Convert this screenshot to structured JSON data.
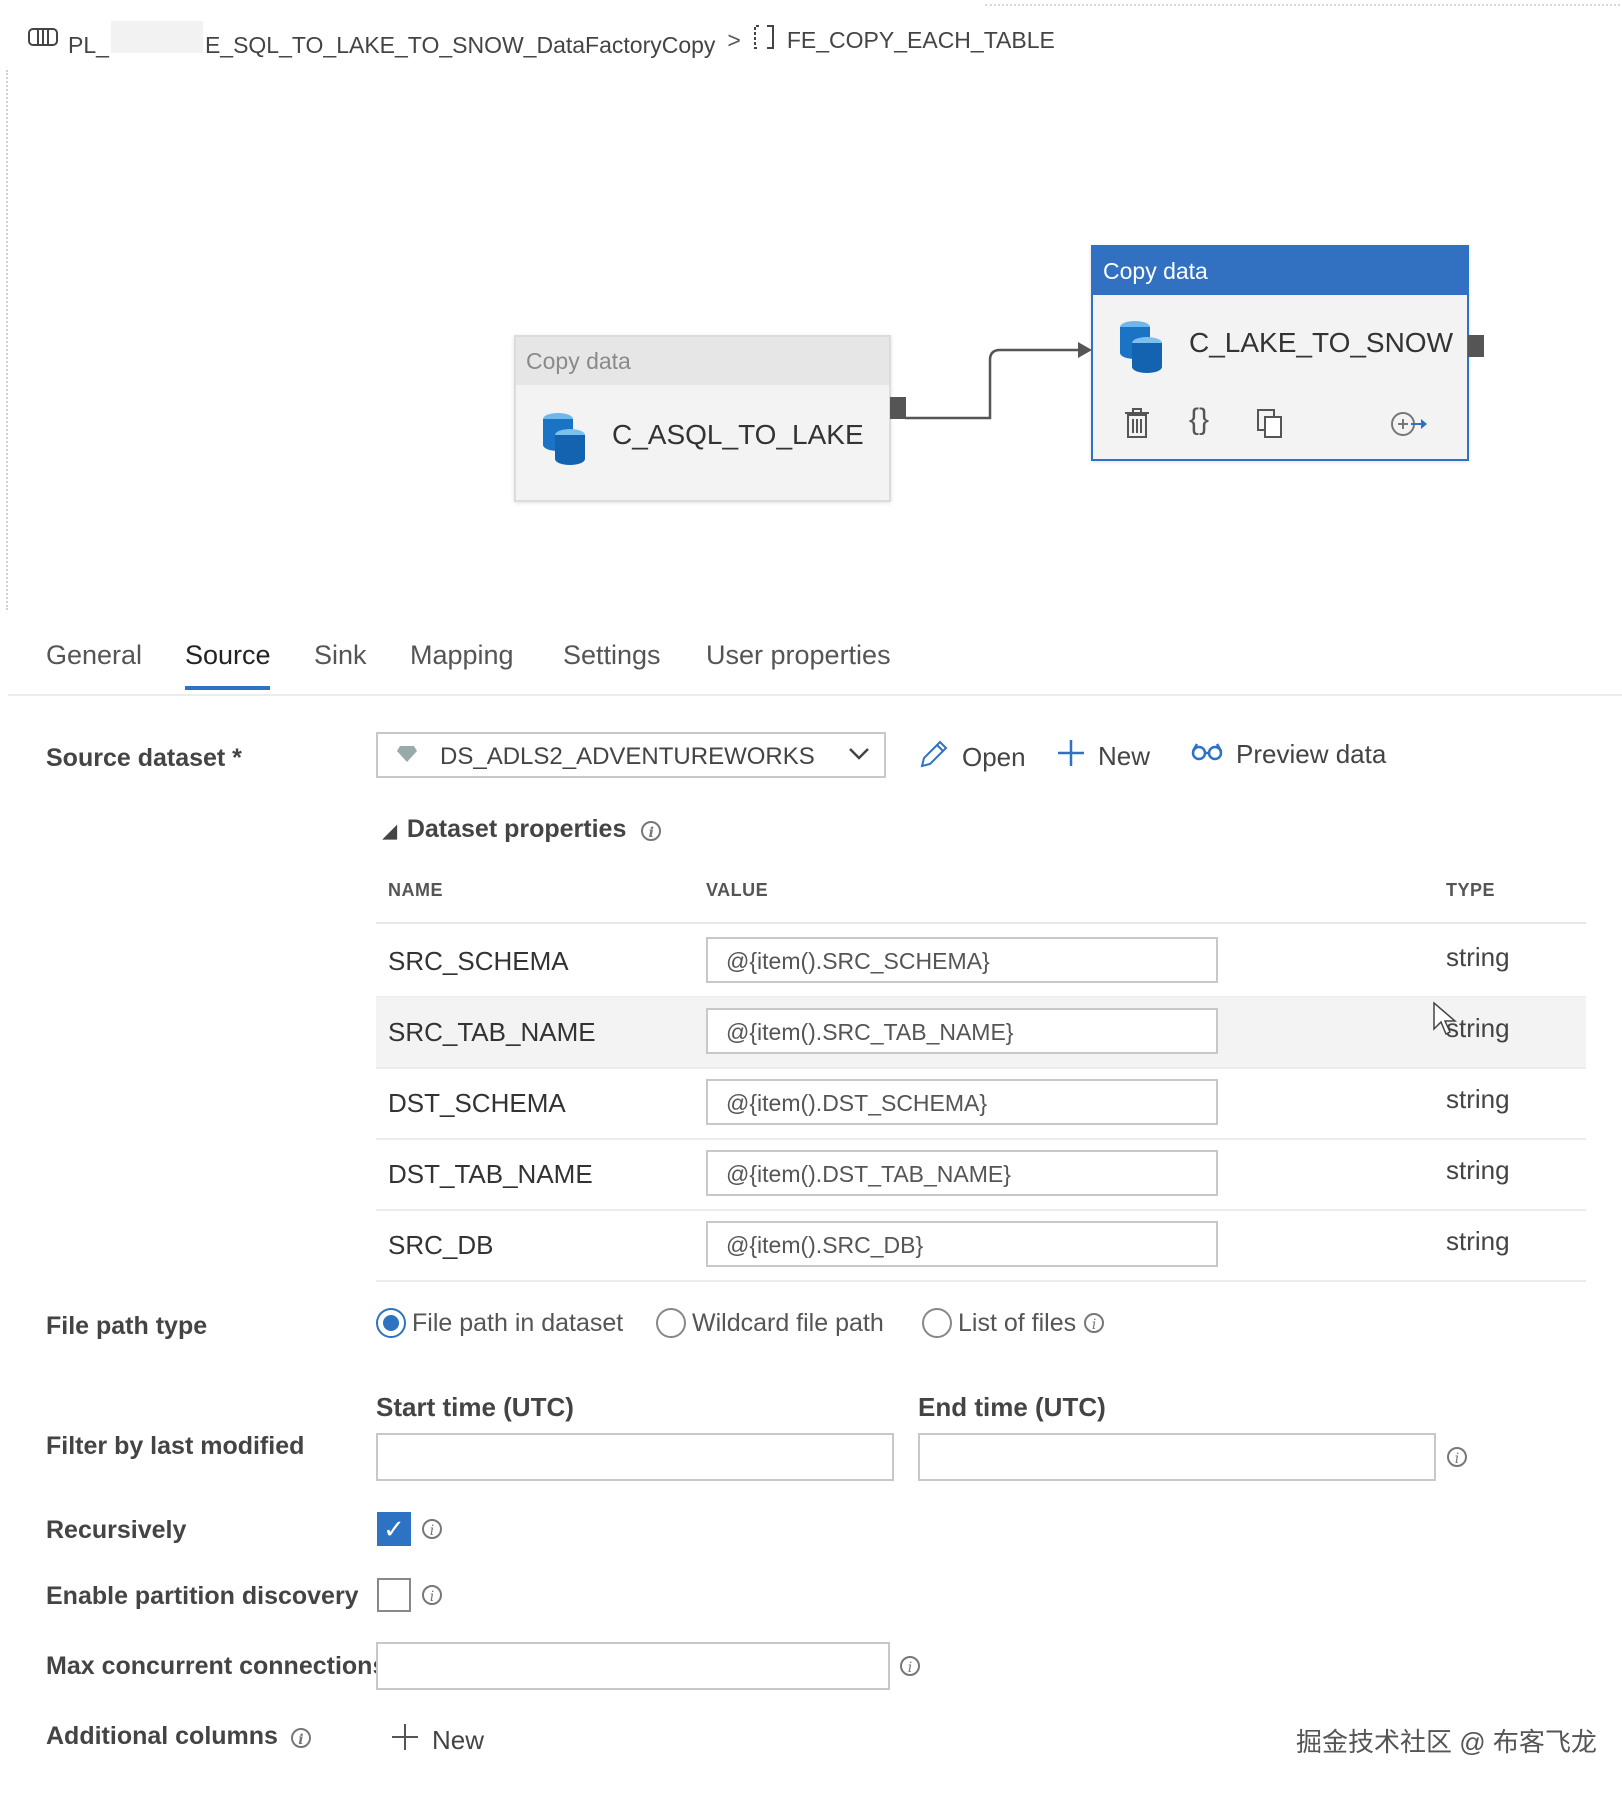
{
  "breadcrumb": {
    "pipeline_prefix": "PL_",
    "pipeline_suffix": "E_SQL_TO_LAKE_TO_SNOW_DataFactoryCopy",
    "separator": ">",
    "foreach": "FE_COPY_EACH_TABLE"
  },
  "canvas": {
    "activities": [
      {
        "type_label": "Copy data",
        "name": "C_ASQL_TO_LAKE"
      },
      {
        "type_label": "Copy data",
        "name": "C_LAKE_TO_SNOW"
      }
    ]
  },
  "tabs": [
    "General",
    "Source",
    "Sink",
    "Mapping",
    "Settings",
    "User properties"
  ],
  "active_tab": "Source",
  "source": {
    "dataset_label": "Source dataset *",
    "dataset_value": "DS_ADLS2_ADVENTUREWORKS",
    "actions": {
      "open": "Open",
      "new": "New",
      "preview": "Preview data"
    },
    "dataset_properties_title": "Dataset properties",
    "columns": {
      "name": "NAME",
      "value": "VALUE",
      "type": "TYPE"
    },
    "properties": [
      {
        "name": "SRC_SCHEMA",
        "value": "@{item().SRC_SCHEMA}",
        "type": "string"
      },
      {
        "name": "SRC_TAB_NAME",
        "value": "@{item().SRC_TAB_NAME}",
        "type": "string"
      },
      {
        "name": "DST_SCHEMA",
        "value": "@{item().DST_SCHEMA}",
        "type": "string"
      },
      {
        "name": "DST_TAB_NAME",
        "value": "@{item().DST_TAB_NAME}",
        "type": "string"
      },
      {
        "name": "SRC_DB",
        "value": "@{item().SRC_DB}",
        "type": "string"
      }
    ],
    "file_path_type_label": "File path type",
    "file_path_options": [
      "File path in dataset",
      "Wildcard file path",
      "List of files"
    ],
    "file_path_selected": "File path in dataset",
    "filter_label": "Filter by last modified",
    "start_time_label": "Start time (UTC)",
    "end_time_label": "End time (UTC)",
    "start_time_value": "",
    "end_time_value": "",
    "recursively_label": "Recursively",
    "recursively_checked": true,
    "partition_label": "Enable partition discovery",
    "partition_checked": false,
    "max_conn_label": "Max concurrent connections",
    "max_conn_value": "",
    "additional_columns_label": "Additional columns",
    "additional_new": "New"
  },
  "watermark": "掘金技术社区 @ 布客飞龙",
  "colors": {
    "accent": "#2e72c3",
    "node_header_active": "#3270c2"
  },
  "icons": [
    "pipeline-icon",
    "foreach-icon",
    "database-icon",
    "delete-icon",
    "code-icon",
    "copy-icon",
    "add-output-icon",
    "pencil-icon",
    "plus-icon",
    "glasses-icon",
    "chevron-down-icon",
    "info-icon",
    "diamond-icon"
  ]
}
